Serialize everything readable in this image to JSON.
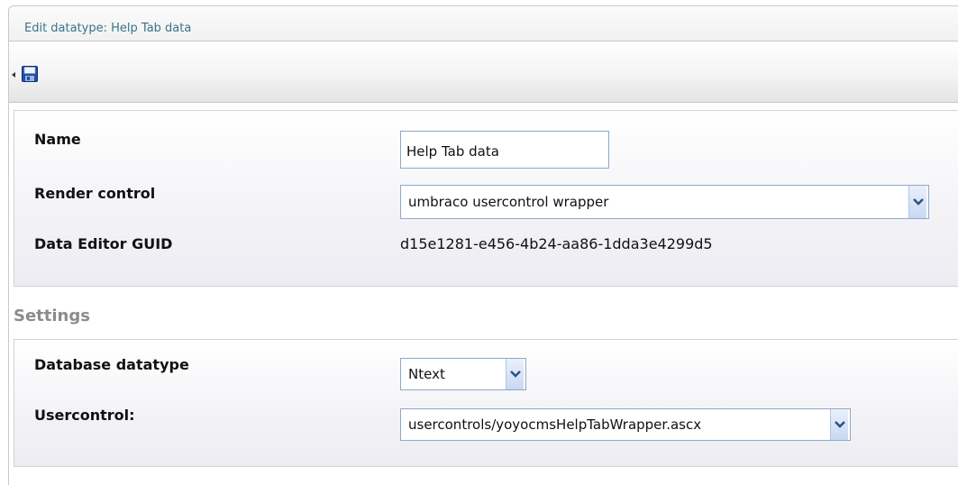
{
  "window": {
    "title": "Edit datatype: Help Tab data"
  },
  "toolbar": {
    "back_icon": "back-arrow-icon",
    "save_icon": "floppy-disk-icon"
  },
  "general": {
    "name_label": "Name",
    "name_value": "Help Tab data",
    "render_control_label": "Render control",
    "render_control_value": "umbraco usercontrol wrapper",
    "guid_label": "Data Editor GUID",
    "guid_value": "d15e1281-e456-4b24-aa86-1dda3e4299d5"
  },
  "settings": {
    "title": "Settings",
    "db_type_label": "Database datatype",
    "db_type_value": "Ntext",
    "usercontrol_label": "Usercontrol:",
    "usercontrol_value": "usercontrols/yoyocmsHelpTabWrapper.ascx"
  },
  "colors": {
    "title_text": "#3a7486",
    "input_border": "#8fa8c8",
    "section_title": "#8c8c8c"
  }
}
